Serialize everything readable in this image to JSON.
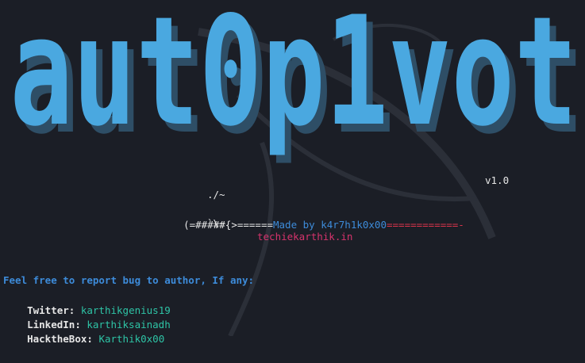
{
  "banner": {
    "title": "aut0p1vot",
    "color": "#4aa8e0",
    "shadow_color": "#2e4e66"
  },
  "version": "v1.0",
  "art": {
    "line1": "./~",
    "line2_prefix": "(=#####{>======",
    "made_by": "Made by k4r7h1k0x00",
    "line2_suffix": "============-",
    "line3": "`\\~"
  },
  "website": "techiekarthik.in",
  "footer": {
    "feel_free": "Feel free to report bug to author, If any:",
    "twitter_label": "Twitter:",
    "twitter_value": "karthikgenius19",
    "linkedin_label": "LinkedIn:",
    "linkedin_value": "karthiksainadh",
    "htb_label": "HacktheBox:",
    "htb_value": "Karthik0x00"
  },
  "colors": {
    "background": "#1b1e26",
    "text": "#e6e6e6",
    "blue": "#3d8bd9",
    "red": "#d9344b",
    "teal": "#2ec4a6",
    "pink": "#d6336c"
  }
}
